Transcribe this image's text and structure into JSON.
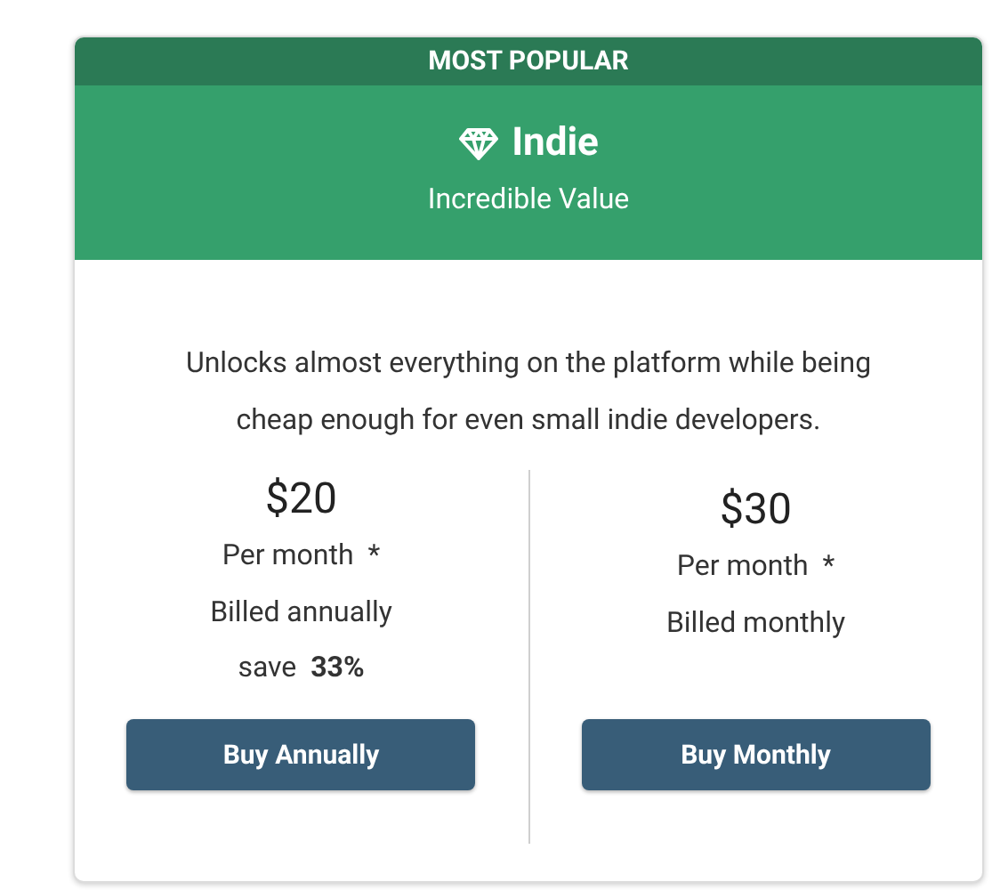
{
  "banner": "MOST POPULAR",
  "plan": {
    "name": "Indie",
    "tagline": "Incredible Value"
  },
  "description": "Unlocks almost everything on the platform while being cheap enough for even small indie developers.",
  "options": [
    {
      "price": "$20",
      "period": "Per month  *",
      "billing": "Billed annually",
      "saving": "save  **33%**",
      "button": "Buy Annually"
    },
    {
      "price": "$30",
      "period": "Per month  *",
      "billing": "Billed monthly",
      "button": "Buy Monthly"
    }
  ]
}
